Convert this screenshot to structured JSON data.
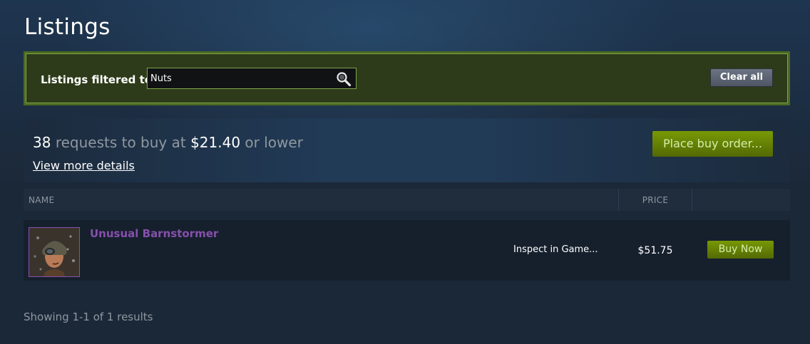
{
  "page": {
    "title": "Listings"
  },
  "filter": {
    "label": "Listings filtered to:",
    "value": "Nuts",
    "clear_label": "Clear all",
    "search_icon": "magnifier-icon"
  },
  "buy_order": {
    "count": "38",
    "text_middle": "requests to buy at",
    "price": "$21.40",
    "text_end": "or lower",
    "details_link": "View more details",
    "place_order_label": "Place buy order..."
  },
  "table": {
    "headers": {
      "name": "NAME",
      "price": "PRICE"
    },
    "rows": [
      {
        "name": "Unusual Barnstormer",
        "inspect_label": "Inspect in Game...",
        "price": "$51.75",
        "buy_label": "Buy Now"
      }
    ]
  },
  "footer": {
    "results": "Showing 1-1 of 1 results"
  },
  "colors": {
    "background": "#1b2838",
    "filter_border": "#7ea64b",
    "unusual_quality": "#8650ac",
    "buy_button": "#799905"
  }
}
